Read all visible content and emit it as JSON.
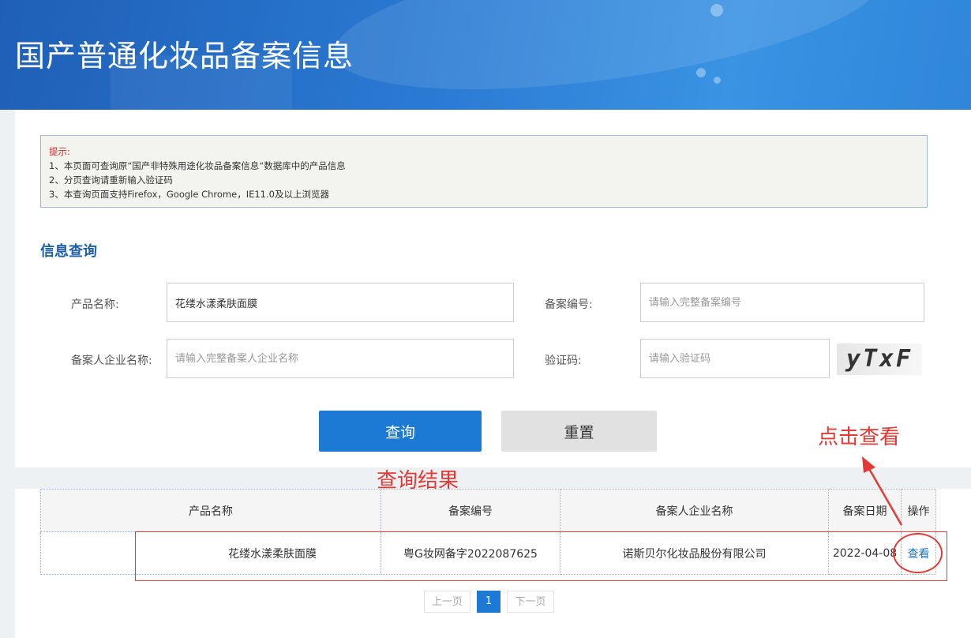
{
  "banner": {
    "title": "国产普通化妆品备案信息"
  },
  "tips": {
    "title": "提示:",
    "lines": [
      "1、本页面可查询原“国产非特殊用途化妆品备案信息“数据库中的产品信息",
      "2、分页查询请重新输入验证码",
      "3、本查询页面支持Firefox，Google Chrome，IE11.0及以上浏览器"
    ]
  },
  "search": {
    "section_title": "信息查询",
    "product_name_label": "产品名称:",
    "product_name_value": "花缕水漾柔肤面膜",
    "record_no_label": "备案编号:",
    "record_no_placeholder": "请输入完整备案编号",
    "company_label": "备案人企业名称:",
    "company_placeholder": "请输入完整备案人企业名称",
    "captcha_label": "验证码:",
    "captcha_placeholder": "请输入验证码",
    "captcha_text": "yTxF",
    "query_button": "查询",
    "reset_button": "重置"
  },
  "results": {
    "headers": [
      "产品名称",
      "备案编号",
      "备案人企业名称",
      "备案日期",
      "操作"
    ],
    "rows": [
      {
        "product_name": "花缕水漾柔肤面膜",
        "record_no": "粤G妆网备字2022087625",
        "company": "诺斯贝尔化妆品股份有限公司",
        "date": "2022-04-08",
        "action": "查看"
      }
    ]
  },
  "pagination": {
    "prev": "上一页",
    "current": "1",
    "next": "下一页"
  },
  "annotations": {
    "click_view": "点击查看",
    "query_result": "查询结果",
    "color": "#e53935"
  },
  "colors": {
    "primary": "#1d7ad4",
    "link": "#1f6fc2",
    "section_title": "#1f5fa8"
  }
}
